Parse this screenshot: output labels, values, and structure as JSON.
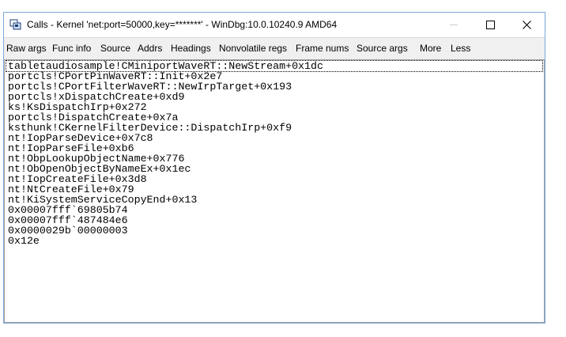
{
  "window": {
    "title": "Calls - Kernel 'net:port=50000,key=*******' - WinDbg:10.0.10240.9 AMD64",
    "controls": {
      "minimize": "minimize-icon",
      "maximize": "maximize-icon",
      "close": "close-icon"
    }
  },
  "toolbar": {
    "items": [
      "Raw args",
      "Func info",
      "Source",
      "Addrs",
      "Headings",
      "Nonvolatile regs",
      "Frame nums",
      "Source args",
      "More",
      "Less"
    ]
  },
  "calls": [
    "tabletaudiosample!CMiniportWaveRT::NewStream+0x1dc",
    "portcls!CPortPinWaveRT::Init+0x2e7",
    "portcls!CPortFilterWaveRT::NewIrpTarget+0x193",
    "portcls!xDispatchCreate+0xd9",
    "ks!KsDispatchIrp+0x272",
    "portcls!DispatchCreate+0x7a",
    "ksthunk!CKernelFilterDevice::DispatchIrp+0xf9",
    "nt!IopParseDevice+0x7c8",
    "nt!IopParseFile+0xb6",
    "nt!ObpLookupObjectName+0x776",
    "nt!ObOpenObjectByNameEx+0x1ec",
    "nt!IopCreateFile+0x3d8",
    "nt!NtCreateFile+0x79",
    "nt!KiSystemServiceCopyEnd+0x13",
    "0x00007fff`69805b74",
    "0x00007fff`487484e6",
    "0x0000029b`00000003",
    "0x12e"
  ]
}
